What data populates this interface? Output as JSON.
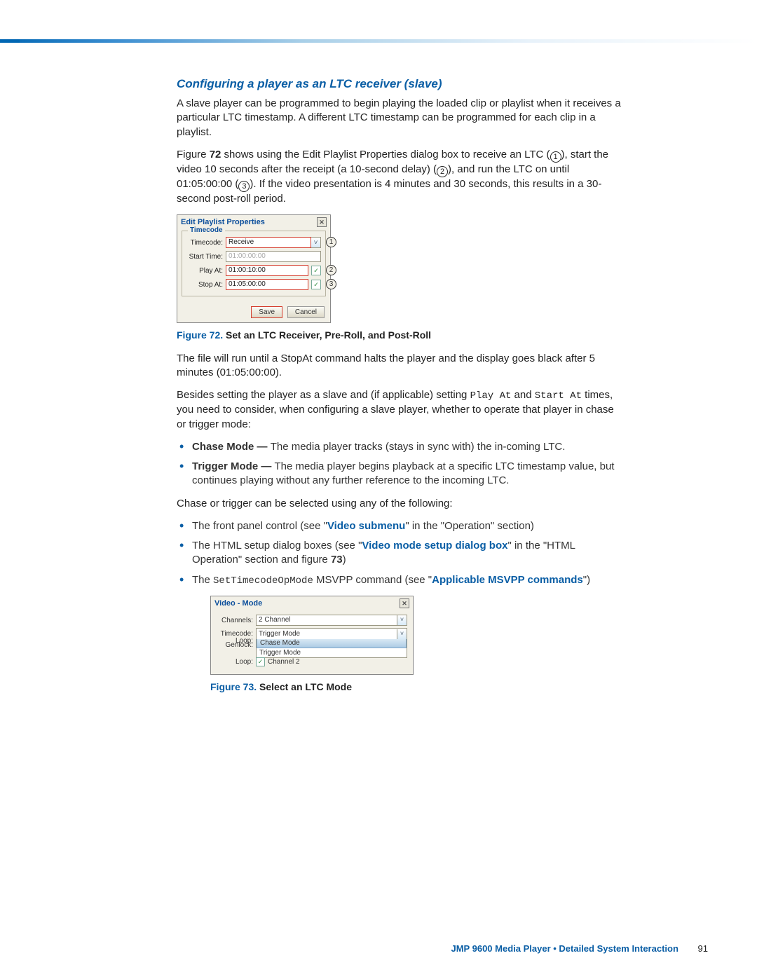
{
  "heading": "Configuring a player as an LTC receiver (slave)",
  "para1": "A slave player can be programmed to begin playing the loaded clip or playlist when it receives a particular LTC timestamp. A different LTC timestamp can be programmed for each clip in a playlist.",
  "para2_a": "Figure ",
  "para2_b": "72",
  "para2_c": " shows using the Edit Playlist Properties dialog box to receive an LTC (",
  "para2_d": "), start the video 10 seconds after the receipt (a 10-second delay) (",
  "para2_e": "), and run the LTC on until 01:05:00:00 (",
  "para2_f": "). If the video presentation is 4 minutes and 30 seconds, this results in a 30-second post-roll period.",
  "circ1": "1",
  "circ2": "2",
  "circ3": "3",
  "dlg1": {
    "title": "Edit Playlist Properties",
    "close": "✕",
    "legend": "Timecode",
    "rows": {
      "timecode_lbl": "Timecode:",
      "timecode_val": "Receive",
      "start_lbl": "Start Time:",
      "start_val": "01:00:00:00",
      "play_lbl": "Play At:",
      "play_val": "01:00:10:00",
      "stop_lbl": "Stop At:",
      "stop_val": "01:05:00:00"
    },
    "chk": "✓",
    "save": "Save",
    "cancel": "Cancel",
    "callouts": {
      "c1": "1",
      "c2": "2",
      "c3": "3"
    },
    "dd": "˅"
  },
  "fig72_num": "Figure 72. ",
  "fig72_title": "Set an LTC Receiver, Pre-Roll, and Post-Roll",
  "para3": "The file will run until a StopAt command halts the player and the display goes black after 5 minutes (01:05:00:00).",
  "para4_a": "Besides setting the player as a slave and (if applicable) setting ",
  "para4_b": "Play At",
  "para4_c": " and ",
  "para4_d": "Start At",
  "para4_e": " times, you need to consider, when configuring a slave player, whether to operate that player in chase or trigger mode:",
  "bullet_chase_a": "Chase Mode — ",
  "bullet_chase_b": "The media player tracks (stays in sync with) the in-coming LTC.",
  "bullet_trigger_a": "Trigger Mode — ",
  "bullet_trigger_b": "The media player begins playback at a specific LTC timestamp value, but continues playing without any further reference to the incoming LTC.",
  "para5": "Chase or trigger can be selected using any of the following:",
  "sel1_a": "The front panel control (see \"",
  "sel1_link": "Video submenu",
  "sel1_b": "\" in the \"Operation\" section)",
  "sel2_a": "The HTML setup dialog boxes (see \"",
  "sel2_link": "Video mode setup dialog box",
  "sel2_b": "\" in the \"HTML Operation\" section and figure ",
  "sel2_c": "73",
  "sel2_d": ")",
  "sel3_a": "The ",
  "sel3_code": "SetTimecodeOpMode",
  "sel3_b": " MSVPP command (see \"",
  "sel3_link": "Applicable MSVPP commands",
  "sel3_c": "\")",
  "dlg2": {
    "title": "Video - Mode",
    "close": "✕",
    "channels_lbl": "Channels:",
    "channels_val": "2 Channel",
    "timecode_lbl": "Timecode:",
    "timecode_val": "Trigger Mode",
    "genlock_lbl": "Genlock:",
    "loop_lbl": "Loop:",
    "opt_chase": "Chase Mode",
    "opt_trigger": "Trigger Mode",
    "loop2_lbl": "Loop:",
    "loop2_val": "Channel 2",
    "dd": "˅",
    "chk": "✓"
  },
  "fig73_num": "Figure 73. ",
  "fig73_title": "Select an LTC Mode",
  "footer_text": "JMP 9600 Media Player • Detailed System Interaction",
  "page_num": "91"
}
